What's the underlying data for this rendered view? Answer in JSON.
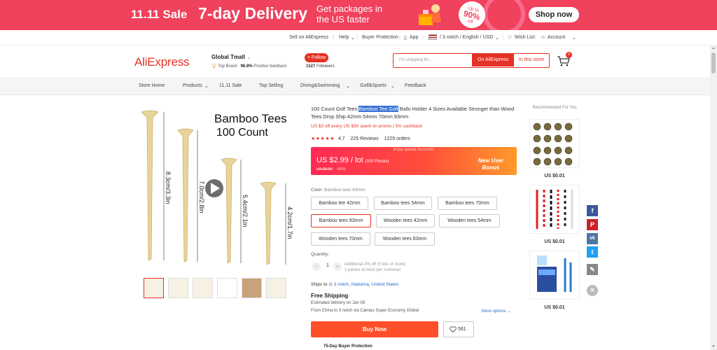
{
  "banner": {
    "sale": "11.11 Sale",
    "delivery": "7-day Delivery",
    "tagline": "Get packages in the US faster",
    "badge_top": "Up to",
    "badge_pct": "90%",
    "badge_bottom": "off",
    "shop_now": "Shop now",
    "bg_color": "#f0415d"
  },
  "topbar": {
    "sell": "Sell on AliExpress",
    "help": "Help",
    "buyer_protection": "Buyer Protection",
    "app": "App",
    "locale": "/ 3 notch / English / USD",
    "wish_list": "Wish List",
    "account": "Account"
  },
  "header": {
    "logo": "AliExpress",
    "store_name": "Global Tmall",
    "top_brand": "Top Brand",
    "positive_pct": "96.8%",
    "positive_label": "Positive feedback",
    "follow": "+ Follow",
    "followers_count": "1527",
    "followers_label": "Followers",
    "search_placeholder": "I'm shopping for...",
    "on_aliexpress": "On AliExpress",
    "in_this_store": "In this store",
    "cart_count": "0",
    "accent": "#e43225"
  },
  "nav": {
    "items": [
      "Store Home",
      "Products",
      "11.11 Sale",
      "Top Selling",
      "Diving&Swimming",
      "Golf&Sports",
      "Feedback"
    ]
  },
  "product": {
    "image_heading_1": "Bamboo Tees",
    "image_heading_2": "100 Count",
    "tee_labels": [
      "8.3cm/3.3in",
      "7.0cm/2.8in",
      "5.4cm/2.1in",
      "4.2cm/1.7in"
    ],
    "title_pre": "100 Count Golf Tees ",
    "title_highlight": "Bamboo Tee Golf",
    "title_post": " Balls Holder 4 Sizes Available Stronger than Wood Tees Drop Ship 42mm 54mm 70mm 83mm",
    "promo": "US $3 off every US $30 spent on promo | 5% cashback",
    "stars": "★★★★★",
    "rating": "4.7",
    "reviews": "225 Reviews",
    "orders": "1229 orders",
    "enjoy": "Enjoy special discounts!",
    "price": "US $2.99 / lot",
    "price_unit": "(100 Pieces)",
    "old_price": "US $8.84",
    "discount": "-66%",
    "new_user_line1": "New User",
    "new_user_line2": "Bonus",
    "color_label": "Color:",
    "color_value": "Bamboo tees 83mm",
    "options": [
      "Bamboo tee 42mm",
      "Bamboo tees 54mm",
      "Bamboo tees 70mm",
      "Bamboo tees 83mm",
      "Wooden tees 42mm",
      "Wooden tees 54mm",
      "Wooden tees 70mm",
      "Wooden tees 83mm"
    ],
    "selected_option": "Bamboo tees 83mm",
    "quantity_label": "Quantity:",
    "quantity": "1",
    "qty_minus": "−",
    "qty_plus": "+",
    "qty_note_1": "Additional 3% off (5 lots or more)",
    "qty_note_2": "1 pieces at most per customer",
    "ships_to": "Ships to",
    "ships_location": "3 notch, Alabama, United States",
    "free_shipping": "Free Shipping",
    "estimated": "Estimated delivery on Jan 08",
    "from_line": "From China to 3 notch via Cainiao Super Economy Global",
    "more_options": "More options",
    "buy_now": "Buy Now",
    "wish_count": "561",
    "protection": "75-Day Buyer Protection"
  },
  "recommended": {
    "title": "Recommended For You",
    "prices": [
      "US $0.01",
      "US $0.01",
      "US $0.01"
    ]
  },
  "social": {
    "facebook": "f",
    "pinterest": "P",
    "vk": "vk",
    "twitter": "t",
    "edit": "✎",
    "close": "×"
  }
}
